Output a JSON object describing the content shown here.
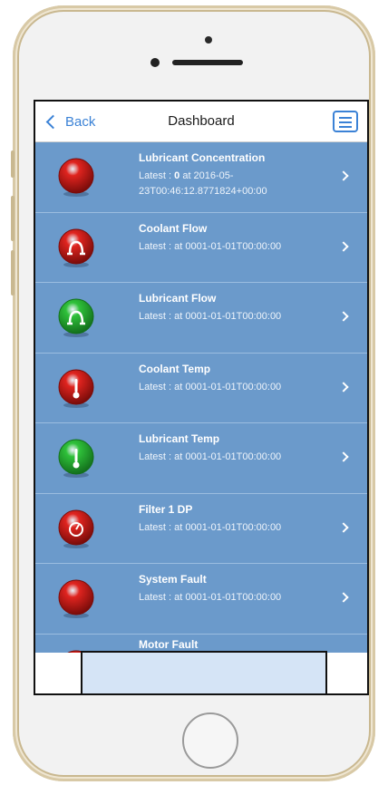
{
  "nav": {
    "back_label": "Back",
    "title": "Dashboard"
  },
  "colors": {
    "list_bg": "#6b9acb",
    "accent": "#3b82d6",
    "red": "#e0241f",
    "green": "#2fc13a"
  },
  "sensors": [
    {
      "title": "Lubricant Concentration",
      "sub_prefix": "Latest : ",
      "value": "0",
      "sub_suffix": " at 2016-05-23T00:46:12.8771824+00:00",
      "status": "red",
      "icon": "blank"
    },
    {
      "title": "Coolant Flow",
      "sub_prefix": "Latest : ",
      "value": "",
      "sub_suffix": " at 0001-01-01T00:00:00",
      "status": "red",
      "icon": "flow-icon"
    },
    {
      "title": "Lubricant Flow",
      "sub_prefix": "Latest : ",
      "value": "",
      "sub_suffix": " at 0001-01-01T00:00:00",
      "status": "green",
      "icon": "flow-icon"
    },
    {
      "title": "Coolant Temp",
      "sub_prefix": "Latest : ",
      "value": "",
      "sub_suffix": " at 0001-01-01T00:00:00",
      "status": "red",
      "icon": "thermometer-icon"
    },
    {
      "title": "Lubricant Temp",
      "sub_prefix": "Latest : ",
      "value": "",
      "sub_suffix": " at 0001-01-01T00:00:00",
      "status": "green",
      "icon": "thermometer-icon"
    },
    {
      "title": "Filter 1 DP",
      "sub_prefix": "Latest : ",
      "value": "",
      "sub_suffix": " at 0001-01-01T00:00:00",
      "status": "red",
      "icon": "gauge-icon"
    },
    {
      "title": "System Fault",
      "sub_prefix": "Latest : ",
      "value": "",
      "sub_suffix": " at 0001-01-01T00:00:00",
      "status": "red",
      "icon": "blank"
    },
    {
      "title": "Motor Fault",
      "sub_prefix": "",
      "value": "",
      "sub_suffix": "",
      "status": "red",
      "icon": "blank"
    }
  ]
}
